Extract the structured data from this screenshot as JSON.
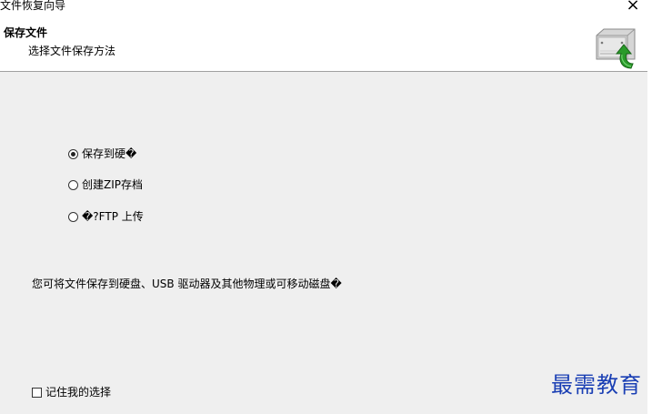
{
  "window": {
    "title": "文件恢复向导",
    "close_glyph": "×"
  },
  "header": {
    "title": "保存文件",
    "subtitle": "选择文件保存方法",
    "icon": "hard-drive-green-arrow-icon"
  },
  "options": [
    {
      "label": "保存到硬�",
      "selected": true
    },
    {
      "label": "创建ZIP存档",
      "selected": false
    },
    {
      "label": "�?FTP 上传",
      "selected": false
    }
  ],
  "description": "您可将文件保存到硬盘、USB 驱动器及其他物理或可移动磁盘�",
  "remember_choice": {
    "label": "记住我的选择",
    "checked": false
  },
  "watermark": "最需教育"
}
